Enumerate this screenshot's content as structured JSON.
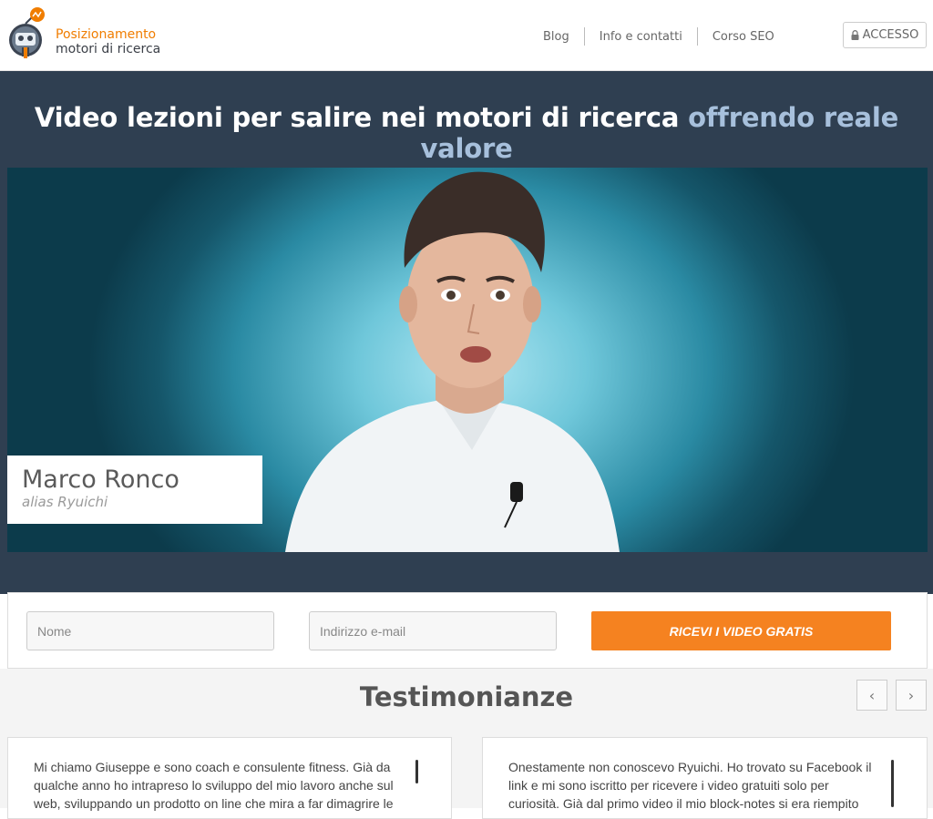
{
  "header": {
    "logo_line1": "Posizionamento",
    "logo_line2": "motori di ricerca",
    "nav": [
      "Blog",
      "Info e contatti",
      "Corso SEO"
    ],
    "access_label": "ACCESSO"
  },
  "hero": {
    "title_main": "Video lezioni per salire nei motori di ricerca",
    "title_accent": "offrendo reale valore",
    "presenter_name": "Marco Ronco",
    "presenter_alias": "alias Ryuichi"
  },
  "form": {
    "name_placeholder": "Nome",
    "email_placeholder": "Indirizzo e-mail",
    "submit_label": "RICEVI I VIDEO GRATIS"
  },
  "testimonials": {
    "title": "Testimonianze",
    "prev_label": "‹",
    "next_label": "›",
    "items": [
      {
        "text": "Mi chiamo Giuseppe e sono coach e consulente fitness. Già da qualche anno ho intrapreso lo sviluppo del mio lavoro anche sul web, sviluppando un prodotto on line che mira a far dimagrire le"
      },
      {
        "text": "Onestamente non conoscevo Ryuichi. Ho trovato su Facebook il link e mi sono iscritto per ricevere i video gratuiti solo per curiosità. Già dal primo video il mio block-notes si era riempito"
      }
    ]
  },
  "colors": {
    "brand_orange": "#f58220",
    "hero_bg": "#2f3f51",
    "accent_blue": "#a7c0dc"
  }
}
